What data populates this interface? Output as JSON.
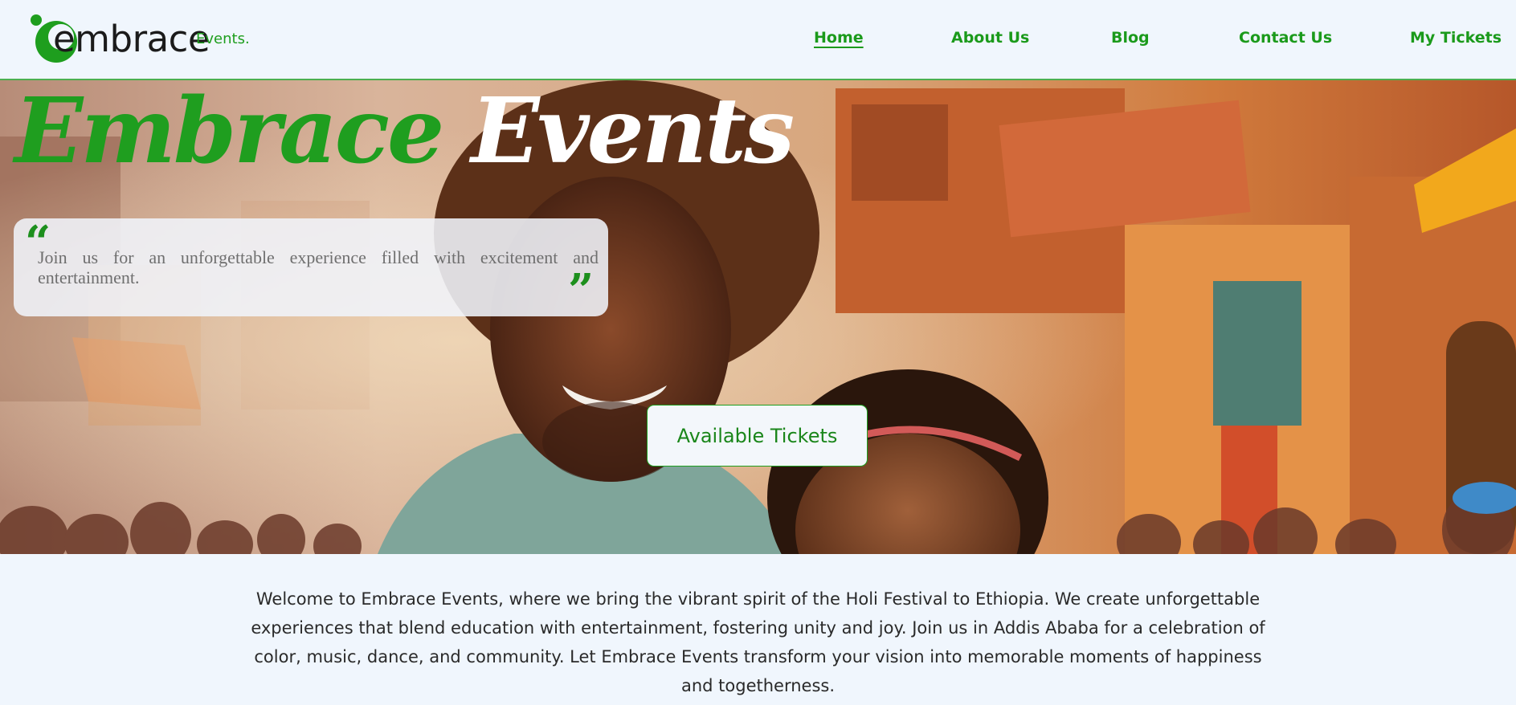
{
  "header": {
    "logo": {
      "word": "embrace",
      "sub": "Events."
    },
    "nav": [
      {
        "label": "Home",
        "active": true
      },
      {
        "label": "About Us",
        "active": false
      },
      {
        "label": "Blog",
        "active": false
      },
      {
        "label": "Contact Us",
        "active": false
      },
      {
        "label": "My Tickets",
        "active": false
      }
    ]
  },
  "hero": {
    "title_green": "Embrace",
    "title_white": "Events",
    "quote_open": "“",
    "quote_close": "”",
    "quote": "Join us for an unforgettable experience filled with excitement and entertainment.",
    "button_label": "Available Tickets"
  },
  "intro": {
    "text": "Welcome to Embrace Events, where we bring the vibrant spirit of the Holi Festival to Ethiopia. We create unforgettable experiences that blend education with entertainment, fostering unity and joy. Join us in Addis Ababa for a celebration of color, music, dance, and community. Let Embrace Events transform your vision into memorable moments of happiness and togetherness."
  },
  "colors": {
    "brand_green": "#1f9e1f",
    "page_background": "#f0f6fd"
  }
}
